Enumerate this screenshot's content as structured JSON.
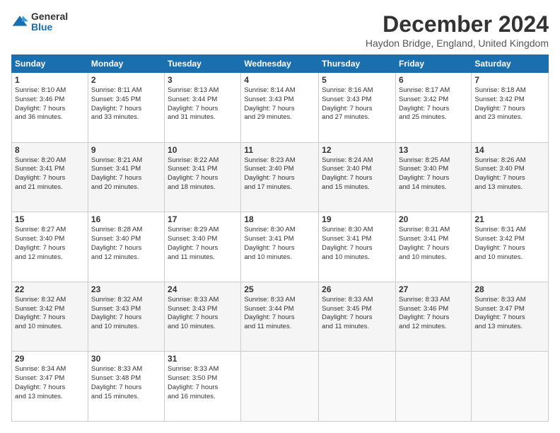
{
  "logo": {
    "general": "General",
    "blue": "Blue"
  },
  "header": {
    "month": "December 2024",
    "location": "Haydon Bridge, England, United Kingdom"
  },
  "days_of_week": [
    "Sunday",
    "Monday",
    "Tuesday",
    "Wednesday",
    "Thursday",
    "Friday",
    "Saturday"
  ],
  "weeks": [
    [
      {
        "day": "1",
        "sunrise": "8:10 AM",
        "sunset": "3:46 PM",
        "daylight": "7 hours and 36 minutes."
      },
      {
        "day": "2",
        "sunrise": "8:11 AM",
        "sunset": "3:45 PM",
        "daylight": "7 hours and 33 minutes."
      },
      {
        "day": "3",
        "sunrise": "8:13 AM",
        "sunset": "3:44 PM",
        "daylight": "7 hours and 31 minutes."
      },
      {
        "day": "4",
        "sunrise": "8:14 AM",
        "sunset": "3:43 PM",
        "daylight": "7 hours and 29 minutes."
      },
      {
        "day": "5",
        "sunrise": "8:16 AM",
        "sunset": "3:43 PM",
        "daylight": "7 hours and 27 minutes."
      },
      {
        "day": "6",
        "sunrise": "8:17 AM",
        "sunset": "3:42 PM",
        "daylight": "7 hours and 25 minutes."
      },
      {
        "day": "7",
        "sunrise": "8:18 AM",
        "sunset": "3:42 PM",
        "daylight": "7 hours and 23 minutes."
      }
    ],
    [
      {
        "day": "8",
        "sunrise": "8:20 AM",
        "sunset": "3:41 PM",
        "daylight": "7 hours and 21 minutes."
      },
      {
        "day": "9",
        "sunrise": "8:21 AM",
        "sunset": "3:41 PM",
        "daylight": "7 hours and 20 minutes."
      },
      {
        "day": "10",
        "sunrise": "8:22 AM",
        "sunset": "3:41 PM",
        "daylight": "7 hours and 18 minutes."
      },
      {
        "day": "11",
        "sunrise": "8:23 AM",
        "sunset": "3:40 PM",
        "daylight": "7 hours and 17 minutes."
      },
      {
        "day": "12",
        "sunrise": "8:24 AM",
        "sunset": "3:40 PM",
        "daylight": "7 hours and 15 minutes."
      },
      {
        "day": "13",
        "sunrise": "8:25 AM",
        "sunset": "3:40 PM",
        "daylight": "7 hours and 14 minutes."
      },
      {
        "day": "14",
        "sunrise": "8:26 AM",
        "sunset": "3:40 PM",
        "daylight": "7 hours and 13 minutes."
      }
    ],
    [
      {
        "day": "15",
        "sunrise": "8:27 AM",
        "sunset": "3:40 PM",
        "daylight": "7 hours and 12 minutes."
      },
      {
        "day": "16",
        "sunrise": "8:28 AM",
        "sunset": "3:40 PM",
        "daylight": "7 hours and 12 minutes."
      },
      {
        "day": "17",
        "sunrise": "8:29 AM",
        "sunset": "3:40 PM",
        "daylight": "7 hours and 11 minutes."
      },
      {
        "day": "18",
        "sunrise": "8:30 AM",
        "sunset": "3:41 PM",
        "daylight": "7 hours and 10 minutes."
      },
      {
        "day": "19",
        "sunrise": "8:30 AM",
        "sunset": "3:41 PM",
        "daylight": "7 hours and 10 minutes."
      },
      {
        "day": "20",
        "sunrise": "8:31 AM",
        "sunset": "3:41 PM",
        "daylight": "7 hours and 10 minutes."
      },
      {
        "day": "21",
        "sunrise": "8:31 AM",
        "sunset": "3:42 PM",
        "daylight": "7 hours and 10 minutes."
      }
    ],
    [
      {
        "day": "22",
        "sunrise": "8:32 AM",
        "sunset": "3:42 PM",
        "daylight": "7 hours and 10 minutes."
      },
      {
        "day": "23",
        "sunrise": "8:32 AM",
        "sunset": "3:43 PM",
        "daylight": "7 hours and 10 minutes."
      },
      {
        "day": "24",
        "sunrise": "8:33 AM",
        "sunset": "3:43 PM",
        "daylight": "7 hours and 10 minutes."
      },
      {
        "day": "25",
        "sunrise": "8:33 AM",
        "sunset": "3:44 PM",
        "daylight": "7 hours and 11 minutes."
      },
      {
        "day": "26",
        "sunrise": "8:33 AM",
        "sunset": "3:45 PM",
        "daylight": "7 hours and 11 minutes."
      },
      {
        "day": "27",
        "sunrise": "8:33 AM",
        "sunset": "3:46 PM",
        "daylight": "7 hours and 12 minutes."
      },
      {
        "day": "28",
        "sunrise": "8:33 AM",
        "sunset": "3:47 PM",
        "daylight": "7 hours and 13 minutes."
      }
    ],
    [
      {
        "day": "29",
        "sunrise": "8:34 AM",
        "sunset": "3:47 PM",
        "daylight": "7 hours and 13 minutes."
      },
      {
        "day": "30",
        "sunrise": "8:33 AM",
        "sunset": "3:48 PM",
        "daylight": "7 hours and 15 minutes."
      },
      {
        "day": "31",
        "sunrise": "8:33 AM",
        "sunset": "3:50 PM",
        "daylight": "7 hours and 16 minutes."
      },
      null,
      null,
      null,
      null
    ]
  ],
  "labels": {
    "sunrise": "Sunrise:",
    "sunset": "Sunset:",
    "daylight": "Daylight:"
  }
}
